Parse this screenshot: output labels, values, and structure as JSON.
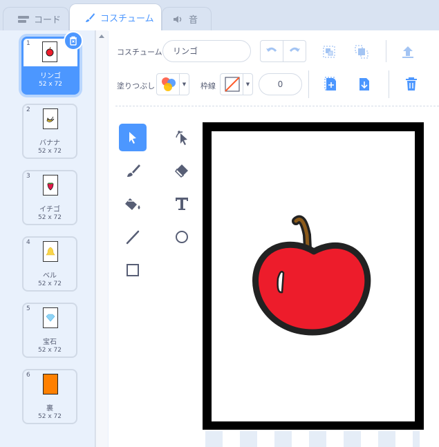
{
  "tabs": [
    {
      "label": "コード",
      "icon": "code-icon"
    },
    {
      "label": "コスチューム",
      "icon": "brush-icon"
    },
    {
      "label": "音",
      "icon": "speaker-icon"
    }
  ],
  "costumes": [
    {
      "num": "1",
      "name": "リンゴ",
      "size": "52 x 72",
      "thumb": "apple"
    },
    {
      "num": "2",
      "name": "バナナ",
      "size": "52 x 72",
      "thumb": "banana"
    },
    {
      "num": "3",
      "name": "イチゴ",
      "size": "52 x 72",
      "thumb": "strawberry"
    },
    {
      "num": "4",
      "name": "ベル",
      "size": "52 x 72",
      "thumb": "bell"
    },
    {
      "num": "5",
      "name": "宝石",
      "size": "52 x 72",
      "thumb": "gem"
    },
    {
      "num": "6",
      "name": "裏",
      "size": "52 x 72",
      "thumb": "back"
    }
  ],
  "editor": {
    "costume_label": "コスチューム",
    "costume_name": "リンゴ",
    "fill_label": "塗りつぶし",
    "outline_label": "枠線",
    "outline_width": "0"
  },
  "colors": {
    "accent": "#4c97ff",
    "apple_red": "#ed1c2b",
    "back_orange": "#ff8000"
  }
}
